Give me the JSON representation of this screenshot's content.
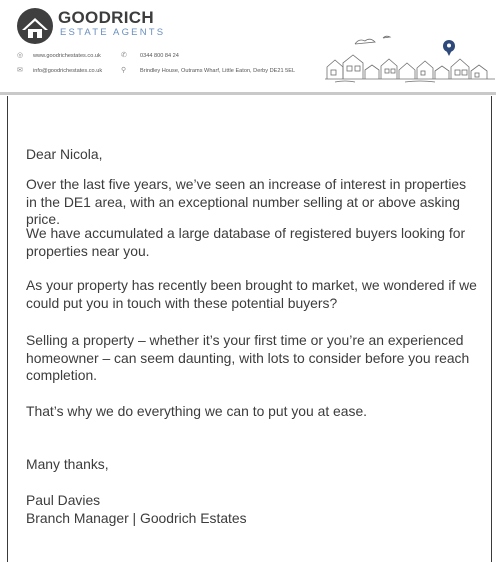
{
  "brand": {
    "name": "GOODRICH",
    "sub": "ESTATE AGENTS"
  },
  "contact": {
    "website": "www.goodrichestates.co.uk",
    "phone": "0344 800 84 24",
    "email": "info@goodrichestates.co.uk",
    "address": "Brindley House, Outrams Wharf, Little Eaton, Derby DE21 5EL"
  },
  "icons": {
    "website": "globe-icon",
    "phone": "phone-icon",
    "email": "envelope-icon",
    "address": "location-pin-icon"
  },
  "colors": {
    "brand_blue": "#6a8fbf",
    "text": "#3c3c3c",
    "pin": "#2f4a7a"
  },
  "letter": {
    "salutation": "Dear Nicola,",
    "paragraphs": [
      "Over the last five years, we’ve seen an increase of interest in properties in the DE1 area, with an exceptional number selling at or above asking price.",
      "We have accumulated a large database of registered buyers looking for properties near you.",
      "As your property has recently been brought to market, we wondered if we could put you in touch with these potential buyers?",
      "Selling a property – whether it’s your first time or you’re an experienced homeowner – can seem daunting, with lots to consider before you reach completion.",
      "That’s why we do everything we can to put you at ease."
    ],
    "closing": "Many thanks,",
    "signature_name": "Paul Davies",
    "signature_title": "Branch Manager | Goodrich Estates"
  }
}
